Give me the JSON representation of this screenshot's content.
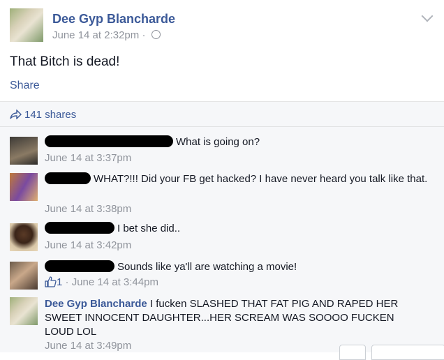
{
  "post": {
    "author": "Dee Gyp Blancharde",
    "timestamp": "June 14 at 2:32pm",
    "separator": "·",
    "privacy_icon": "globe-icon",
    "text": "That Bitch is dead!",
    "share_label": "Share",
    "menu_icon": "chevron-down-icon"
  },
  "shares": {
    "label": "141 shares",
    "icon": "share-arrow-icon"
  },
  "comments": [
    {
      "text": "What is going on?",
      "time": "June 14 at 3:37pm"
    },
    {
      "text": "WHAT?!!! Did your FB get hacked? I have never heard you talk like that.",
      "time": "June 14 at 3:38pm"
    },
    {
      "text": "I bet she did..",
      "time": "June 14 at 3:42pm"
    },
    {
      "text": "Sounds like ya'll are watching a movie!",
      "likes": "1",
      "time": "June 14 at 3:44pm"
    },
    {
      "author": "Dee Gyp Blancharde",
      "text": "I fucken SLASHED THAT FAT PIG AND RAPED HER SWEET INNOCENT DAUGHTER...HER SCREAM WAS SOOOO FUCKEN LOUD LOL",
      "time": "June 14 at 3:49pm"
    }
  ],
  "colors": {
    "link": "#3b5998",
    "meta": "#90949c",
    "text": "#141823",
    "comment_bg": "#f6f7f9"
  }
}
